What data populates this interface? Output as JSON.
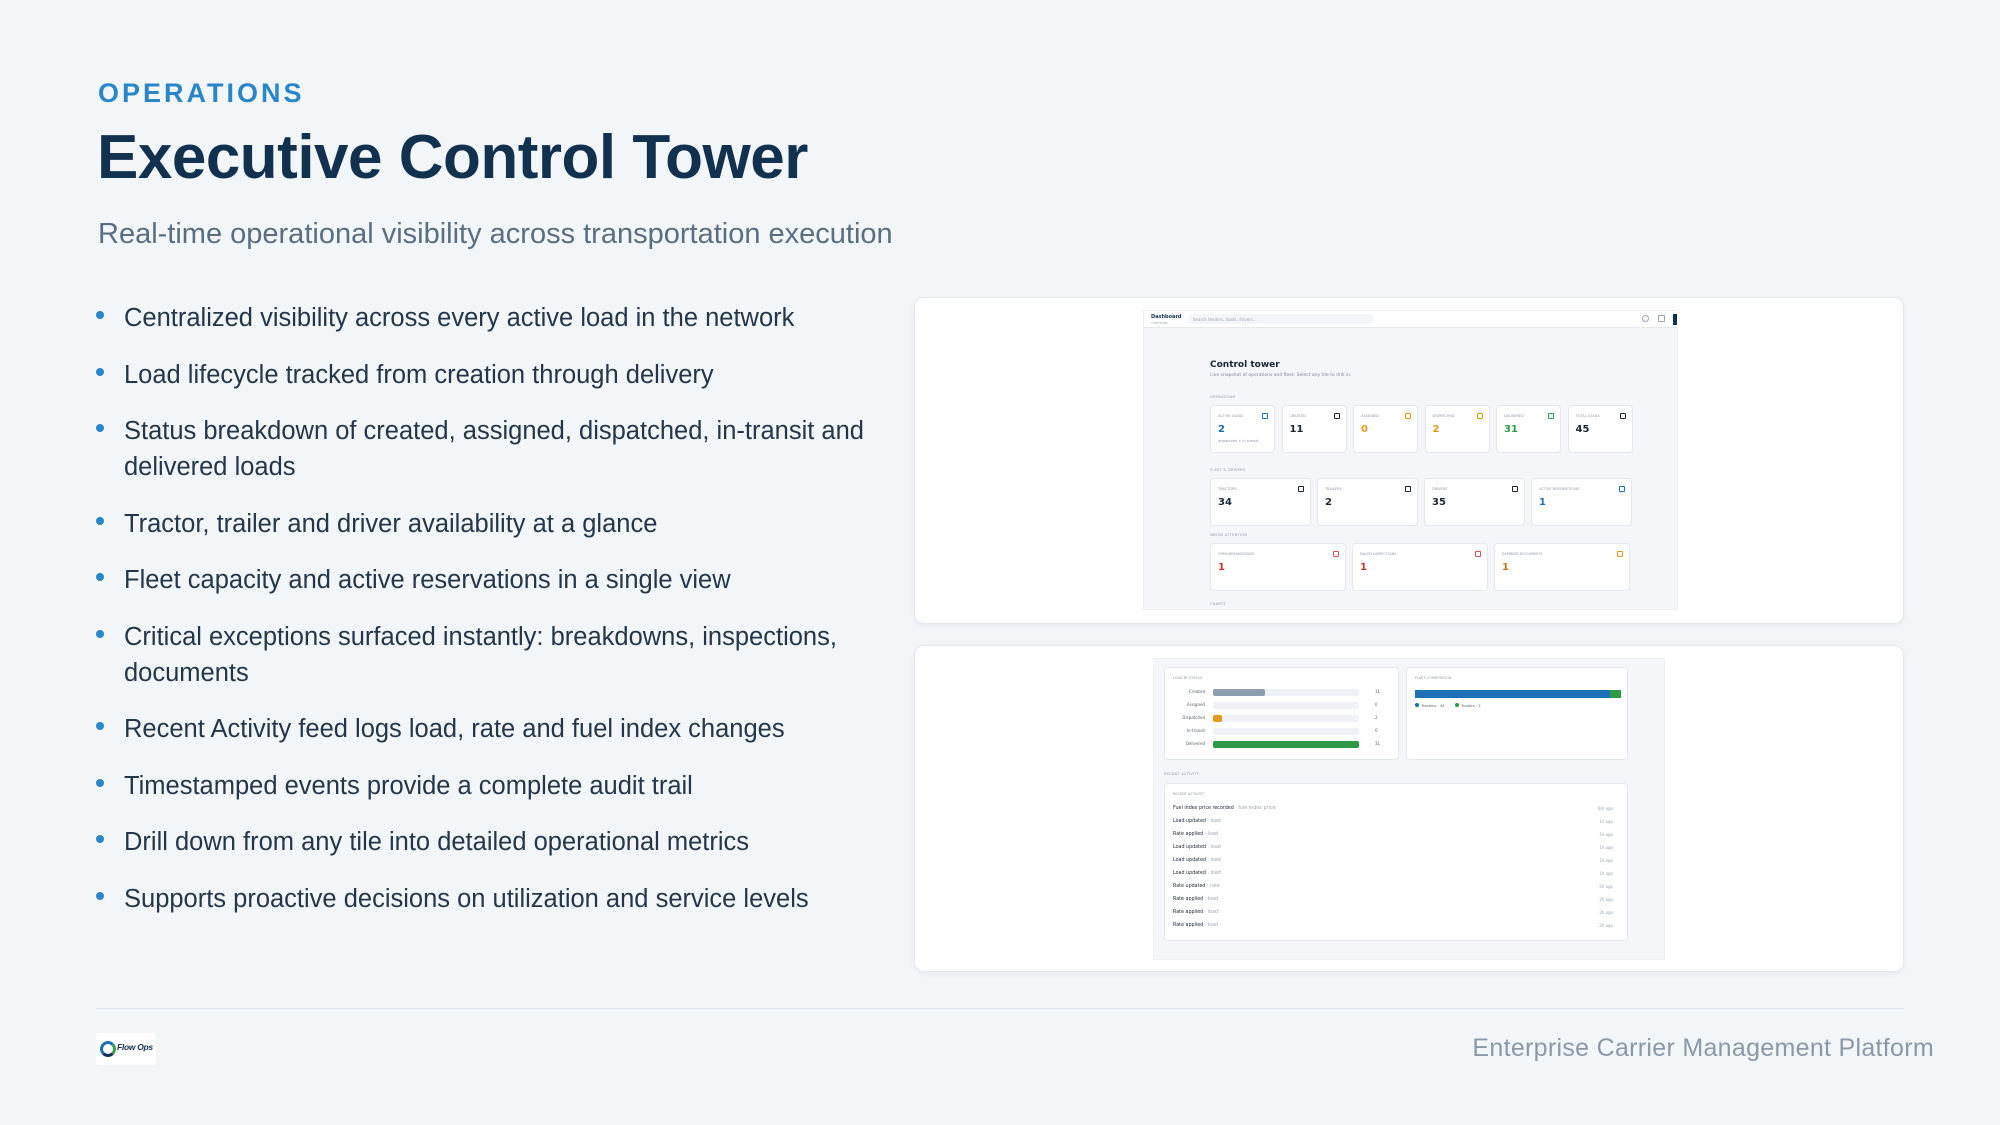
{
  "header": {
    "eyebrow": "OPERATIONS",
    "title": "Executive Control Tower",
    "subtitle": "Real-time operational visibility across transportation execution"
  },
  "bullets": [
    "Centralized visibility across every active load in the network",
    "Load lifecycle tracked from creation through delivery",
    "Status breakdown of created, assigned, dispatched, in-transit and delivered loads",
    "Tractor, trailer and driver availability at a glance",
    "Fleet capacity and active reservations in a single view",
    "Critical exceptions surfaced instantly: breakdowns, inspections, documents",
    "Recent Activity feed logs load, rate and fuel index changes",
    "Timestamped events provide a complete audit trail",
    "Drill down from any tile into detailed operational metrics",
    "Supports proactive decisions on utilization and service levels"
  ],
  "dashboard": {
    "topbar_title": "Dashboard",
    "topbar_sub": "Overview",
    "search_placeholder": "Search tenders, loads, drivers...",
    "heading": "Control tower",
    "subheading": "Live snapshot of operations and fleet. Select any tile to drill in.",
    "sections": {
      "operations": "OPERATIONS",
      "fleet": "FLEET & DRIVERS",
      "attention": "NEEDS ATTENTION",
      "charts": "CHARTS"
    },
    "operations_tiles": [
      {
        "label": "ACTIVE LOADS",
        "value": "2",
        "note": "dispatched + in-transit",
        "color": "#1d6fb8"
      },
      {
        "label": "CREATED",
        "value": "11",
        "note": "",
        "color": "#1a2733"
      },
      {
        "label": "ASSIGNED",
        "value": "0",
        "note": "",
        "color": "#e39a1e"
      },
      {
        "label": "DISPATCHED",
        "value": "2",
        "note": "",
        "color": "#e39a1e"
      },
      {
        "label": "DELIVERED",
        "value": "31",
        "note": "",
        "color": "#2e9a48"
      },
      {
        "label": "TOTAL LOADS",
        "value": "45",
        "note": "",
        "color": "#1a2733"
      }
    ],
    "fleet_tiles": [
      {
        "label": "TRACTORS",
        "value": "34",
        "color": "#1a2733"
      },
      {
        "label": "TRAILERS",
        "value": "2",
        "color": "#1a2733"
      },
      {
        "label": "DRIVERS",
        "value": "35",
        "color": "#1a2733"
      },
      {
        "label": "ACTIVE RESERVATIONS",
        "value": "1",
        "color": "#1d6fb8"
      }
    ],
    "attention_tiles": [
      {
        "label": "OPEN BREAKDOWNS",
        "value": "1",
        "color": "#c0392b",
        "icon": "#d9534f"
      },
      {
        "label": "FAILED INSPECTIONS",
        "value": "1",
        "color": "#c0392b",
        "icon": "#d9534f"
      },
      {
        "label": "EXPIRING DOCUMENTS",
        "value": "1",
        "color": "#c07a12",
        "icon": "#e39a1e"
      }
    ]
  },
  "dashboard2": {
    "load_status_label": "LOAD BY STATUS",
    "fleet_comp_label": "FLEET COMPOSITION",
    "recent_section": "RECENT ACTIVITY",
    "recent_panel": "RECENT ACTIVITY",
    "load_status": [
      {
        "label": "Created",
        "value": 11,
        "color": "#8f9db0"
      },
      {
        "label": "Assigned",
        "value": 0,
        "color": "#8f9db0"
      },
      {
        "label": "Dispatched",
        "value": 2,
        "color": "#e39a1e"
      },
      {
        "label": "In-transit",
        "value": 0,
        "color": "#1d6fb8"
      },
      {
        "label": "Delivered",
        "value": 31,
        "color": "#2e9a48"
      }
    ],
    "load_status_max": 31,
    "fleet_composition": [
      {
        "label": "Tractors · 34",
        "value": 34,
        "color": "#1d6fb8"
      },
      {
        "label": "Trailers · 2",
        "value": 2,
        "color": "#2e9a48"
      }
    ],
    "activity": [
      {
        "name": "Fuel index price recorded",
        "type": "· fuel index price",
        "time": "6m ago"
      },
      {
        "name": "Load updated",
        "type": "· load",
        "time": "1h ago"
      },
      {
        "name": "Rate applied",
        "type": "· load",
        "time": "1h ago"
      },
      {
        "name": "Load updated",
        "type": "· load",
        "time": "1h ago"
      },
      {
        "name": "Load updated",
        "type": "· load",
        "time": "1h ago"
      },
      {
        "name": "Load updated",
        "type": "· load",
        "time": "1h ago"
      },
      {
        "name": "Rate updated",
        "type": "· rate",
        "time": "2h ago"
      },
      {
        "name": "Rate applied",
        "type": "· load",
        "time": "2h ago"
      },
      {
        "name": "Rate applied",
        "type": "· load",
        "time": "2h ago"
      },
      {
        "name": "Rate applied",
        "type": "· load",
        "time": "2h ago"
      }
    ]
  },
  "footer": {
    "logo_text": "Flow Ops",
    "platform": "Enterprise Carrier Management Platform"
  }
}
